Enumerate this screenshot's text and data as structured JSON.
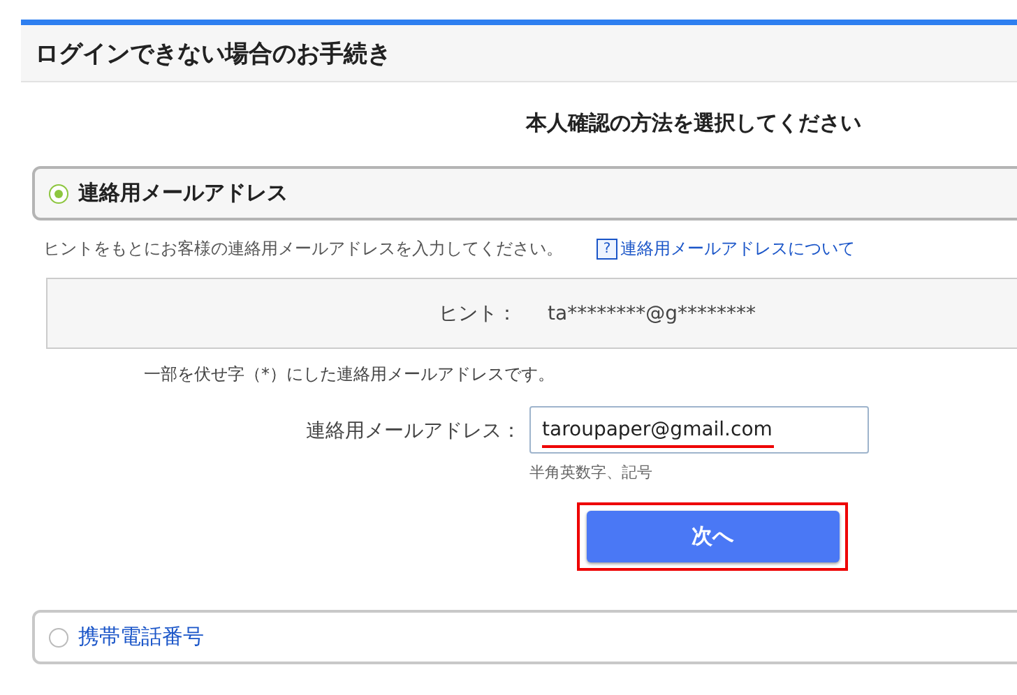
{
  "page_title": "ログインできない場合のお手続き",
  "subtitle": "本人確認の方法を選択してください",
  "methods": [
    {
      "label": "連絡用メールアドレス",
      "selected": true,
      "instruction": "ヒントをもとにお客様の連絡用メールアドレスを入力してください。",
      "help_link": {
        "icon": "?",
        "label": "連絡用メールアドレスについて"
      },
      "hint": {
        "label": "ヒント：",
        "value": "ta********@g********"
      },
      "hint_note": "一部を伏せ字（*）にした連絡用メールアドレスです。",
      "field": {
        "label": "連絡用メールアドレス：",
        "value": "taroupaper@gmail.com",
        "help": "半角英数字、記号",
        "underlined": true
      },
      "submit": {
        "label": "次へ",
        "highlighted": true
      }
    },
    {
      "label": "携帯電話番号",
      "selected": false
    }
  ]
}
